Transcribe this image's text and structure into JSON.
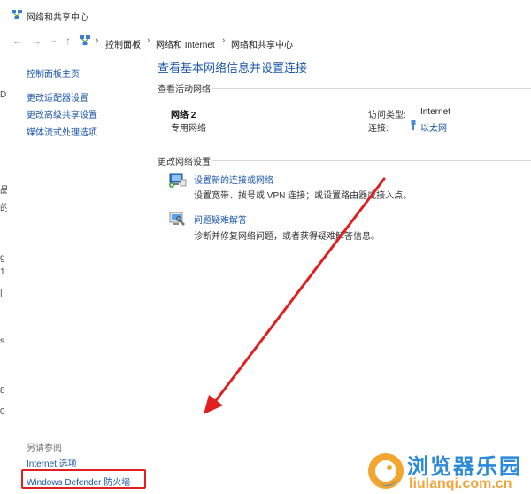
{
  "window": {
    "title": "网络和共享中心"
  },
  "navigation": {
    "back_glyph": "←",
    "forward_glyph": "→",
    "recent_glyph": "⌄",
    "up_glyph": "↑",
    "separator_glyph": "›",
    "breadcrumb": [
      "控制面板",
      "网络和 Internet",
      "网络和共享中心"
    ]
  },
  "left_edge": {
    "marks": [
      "D",
      "品",
      "的",
      "g",
      "1",
      "|",
      "s",
      "8",
      "0"
    ]
  },
  "sidebar": {
    "links": [
      "控制面板主页",
      "更改适配器设置",
      "更改高级共享设置",
      "媒体流式处理选项"
    ],
    "see_also_label": "另请参阅",
    "see_also_links": [
      "Internet 选项",
      "Windows Defender 防火墙"
    ]
  },
  "main": {
    "heading": "查看基本网络信息并设置连接",
    "active_section_label": "查看活动网络",
    "network": {
      "name": "网络 2",
      "type": "专用网络",
      "access_type_label": "访问类型:",
      "access_type_value": "Internet",
      "connection_label": "连接:",
      "connection_value": "以太网"
    },
    "change_section_label": "更改网络设置",
    "tasks": [
      {
        "icon": "network-setup-icon",
        "title": "设置新的连接或网络",
        "description": "设置宽带、拨号或 VPN 连接；或设置路由器或接入点。"
      },
      {
        "icon": "troubleshoot-icon",
        "title": "问题疑难解答",
        "description": "诊断并修复网络问题，或者获得疑难解答信息。"
      }
    ]
  },
  "annotation": {
    "arrow_color": "#e02020",
    "box_color": "#e02020"
  },
  "watermark": {
    "text": "浏览器乐园",
    "url": "liulanqi.com.cn",
    "text_color": "#2c8ad8",
    "url_color": "#f0a53a"
  },
  "colors": {
    "link": "#1a55a8",
    "background": "#ffffff"
  }
}
